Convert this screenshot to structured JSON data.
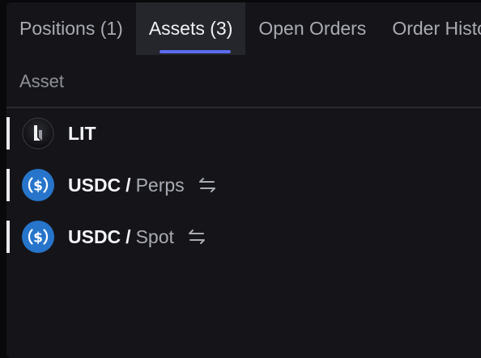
{
  "tabs": [
    {
      "label": "Positions (1)",
      "active": false
    },
    {
      "label": "Assets (3)",
      "active": true
    },
    {
      "label": "Open Orders",
      "active": false
    },
    {
      "label": "Order History",
      "active": false
    }
  ],
  "table": {
    "column_header": "Asset",
    "rows": [
      {
        "asset": "LIT",
        "market": "",
        "icon": "lit-logo-icon",
        "transfer": false
      },
      {
        "asset": "USDC",
        "separator": "/",
        "market": "Perps",
        "icon": "usdc-icon",
        "transfer": true,
        "transfer_icon": "transfer-arrows-icon"
      },
      {
        "asset": "USDC",
        "separator": "/",
        "market": "Spot",
        "icon": "usdc-icon",
        "transfer": true,
        "transfer_icon": "transfer-arrows-icon"
      }
    ]
  },
  "colors": {
    "background": "#151519",
    "active_tab": "#25262b",
    "accent": "#5a6df0",
    "usdc_blue": "#2775ca"
  }
}
